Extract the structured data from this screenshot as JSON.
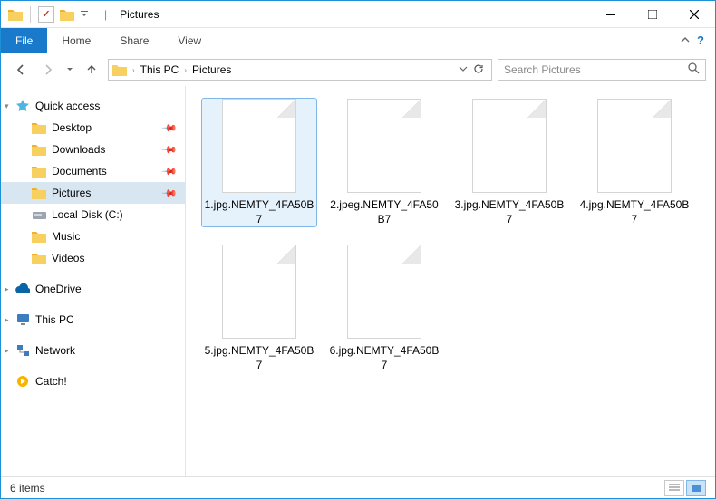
{
  "titlebar": {
    "title": "Pictures",
    "sep": "|"
  },
  "ribbon": {
    "file": "File",
    "tabs": [
      "Home",
      "Share",
      "View"
    ]
  },
  "breadcrumb": {
    "items": [
      "This PC",
      "Pictures"
    ]
  },
  "search": {
    "placeholder": "Search Pictures"
  },
  "sidebar": {
    "quick_access": "Quick access",
    "qa_items": [
      {
        "label": "Desktop",
        "pin": true
      },
      {
        "label": "Downloads",
        "pin": true
      },
      {
        "label": "Documents",
        "pin": true
      },
      {
        "label": "Pictures",
        "pin": true,
        "selected": true
      },
      {
        "label": "Local Disk (C:)",
        "pin": false,
        "icon": "disk"
      },
      {
        "label": "Music",
        "pin": false
      },
      {
        "label": "Videos",
        "pin": false
      }
    ],
    "onedrive": "OneDrive",
    "thispc": "This PC",
    "network": "Network",
    "catch": "Catch!"
  },
  "files": [
    {
      "name": "1.jpg.NEMTY_4FA50B7",
      "selected": true
    },
    {
      "name": "2.jpeg.NEMTY_4FA50B7"
    },
    {
      "name": "3.jpg.NEMTY_4FA50B7"
    },
    {
      "name": "4.jpg.NEMTY_4FA50B7"
    },
    {
      "name": "5.jpg.NEMTY_4FA50B7"
    },
    {
      "name": "6.jpg.NEMTY_4FA50B7"
    }
  ],
  "status": {
    "count": "6 items"
  }
}
